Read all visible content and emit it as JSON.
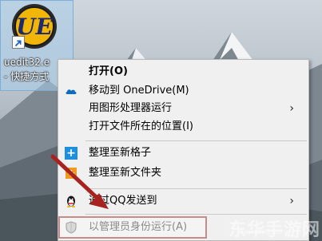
{
  "desktop": {
    "shortcut": {
      "name_line1": "uedit32.e",
      "name_line2": "- 快捷方式",
      "logo_text": "UE"
    }
  },
  "context_menu": {
    "items": [
      {
        "label": "打开(O)",
        "icon": "none",
        "bold": true,
        "submenu": false
      },
      {
        "label": "移动到 OneDrive(M)",
        "icon": "onedrive-cloud-icon",
        "submenu": false
      },
      {
        "label": "用图形处理器运行",
        "icon": "none",
        "submenu": true
      },
      {
        "label": "打开文件所在的位置(I)",
        "icon": "none",
        "submenu": false
      },
      {
        "label": "整理至新格子",
        "icon": "blue-plus-icon",
        "submenu": false
      },
      {
        "label": "整理至新文件夹",
        "icon": "orange-folder-icon",
        "submenu": false
      },
      {
        "label": "通过QQ发送到",
        "icon": "qq-penguin-icon",
        "submenu": true
      },
      {
        "label": "以管理员身份运行(A)",
        "icon": "uac-shield-icon",
        "submenu": false,
        "disabled": true
      }
    ],
    "submenu_arrow": "›"
  },
  "watermark": {
    "text": "东华手游网",
    "subtext": "www.dhsy.com"
  },
  "colors": {
    "menu_bg": "#f0f0f0",
    "highlight_box": "#c98a8a",
    "annotation_arrow": "#a8231f",
    "selection_bg": "#aacdeb"
  }
}
